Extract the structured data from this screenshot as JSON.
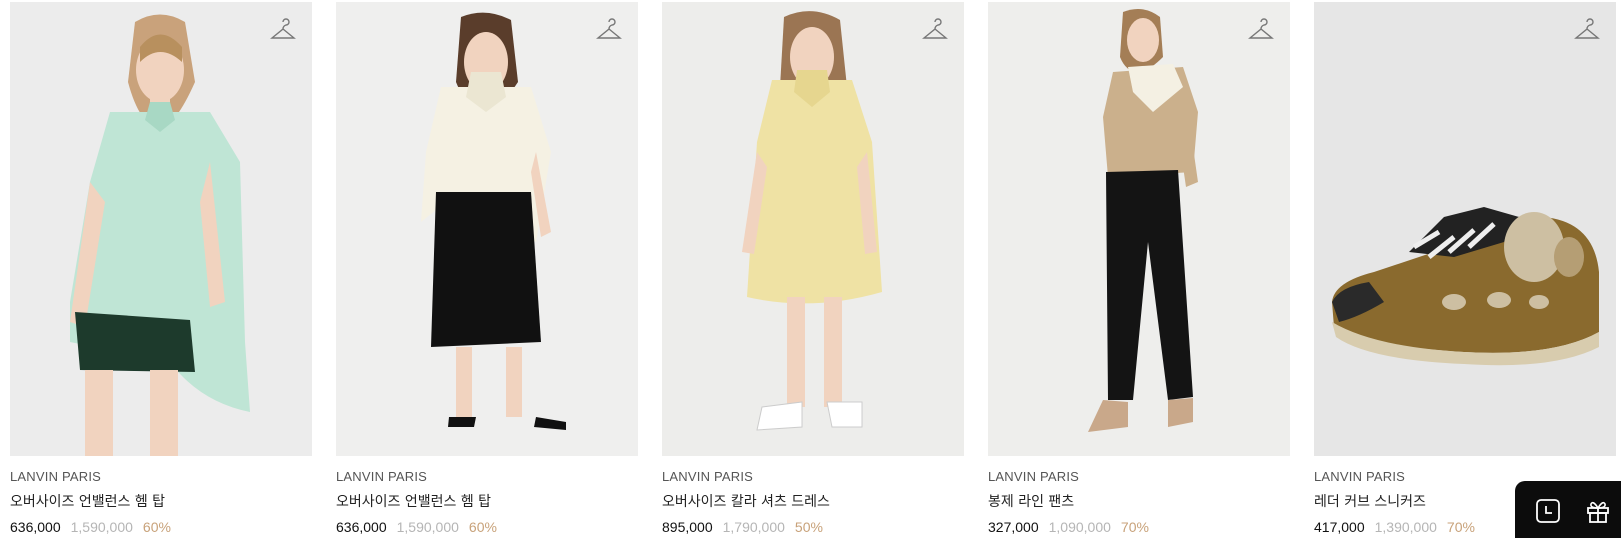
{
  "products": [
    {
      "brand": "LANVIN PARIS",
      "name": "오버사이즈 언밸런스 헴 탑",
      "price": "636,000",
      "original_price": "1,590,000",
      "discount": "60%",
      "image": "mint-oversized-top",
      "bg": "#ececec"
    },
    {
      "brand": "LANVIN PARIS",
      "name": "오버사이즈 언밸런스 헴 탑",
      "price": "636,000",
      "original_price": "1,590,000",
      "discount": "60%",
      "image": "ivory-oversized-top",
      "bg": "#efefee"
    },
    {
      "brand": "LANVIN PARIS",
      "name": "오버사이즈 칼라 셔츠 드레스",
      "price": "895,000",
      "original_price": "1,790,000",
      "discount": "50%",
      "image": "yellow-shirt-dress",
      "bg": "#ededeb"
    },
    {
      "brand": "LANVIN PARIS",
      "name": "봉제 라인 팬츠",
      "price": "327,000",
      "original_price": "1,090,000",
      "discount": "70%",
      "image": "black-pants-beige-knit",
      "bg": "#eeeeec"
    },
    {
      "brand": "LANVIN PARIS",
      "name": "레더 커브 스니커즈",
      "price": "417,000",
      "original_price": "1,390,000",
      "discount": "70%",
      "image": "brown-curb-sneaker",
      "bg": "#e6e6e6"
    }
  ],
  "icons": {
    "wishlist": "hanger-icon",
    "recent": "clock-icon",
    "gift": "gift-icon"
  },
  "colors": {
    "discount": "#c8a27a",
    "original_price": "#b5b5b5",
    "floating_bar": "#0c0c0c"
  }
}
